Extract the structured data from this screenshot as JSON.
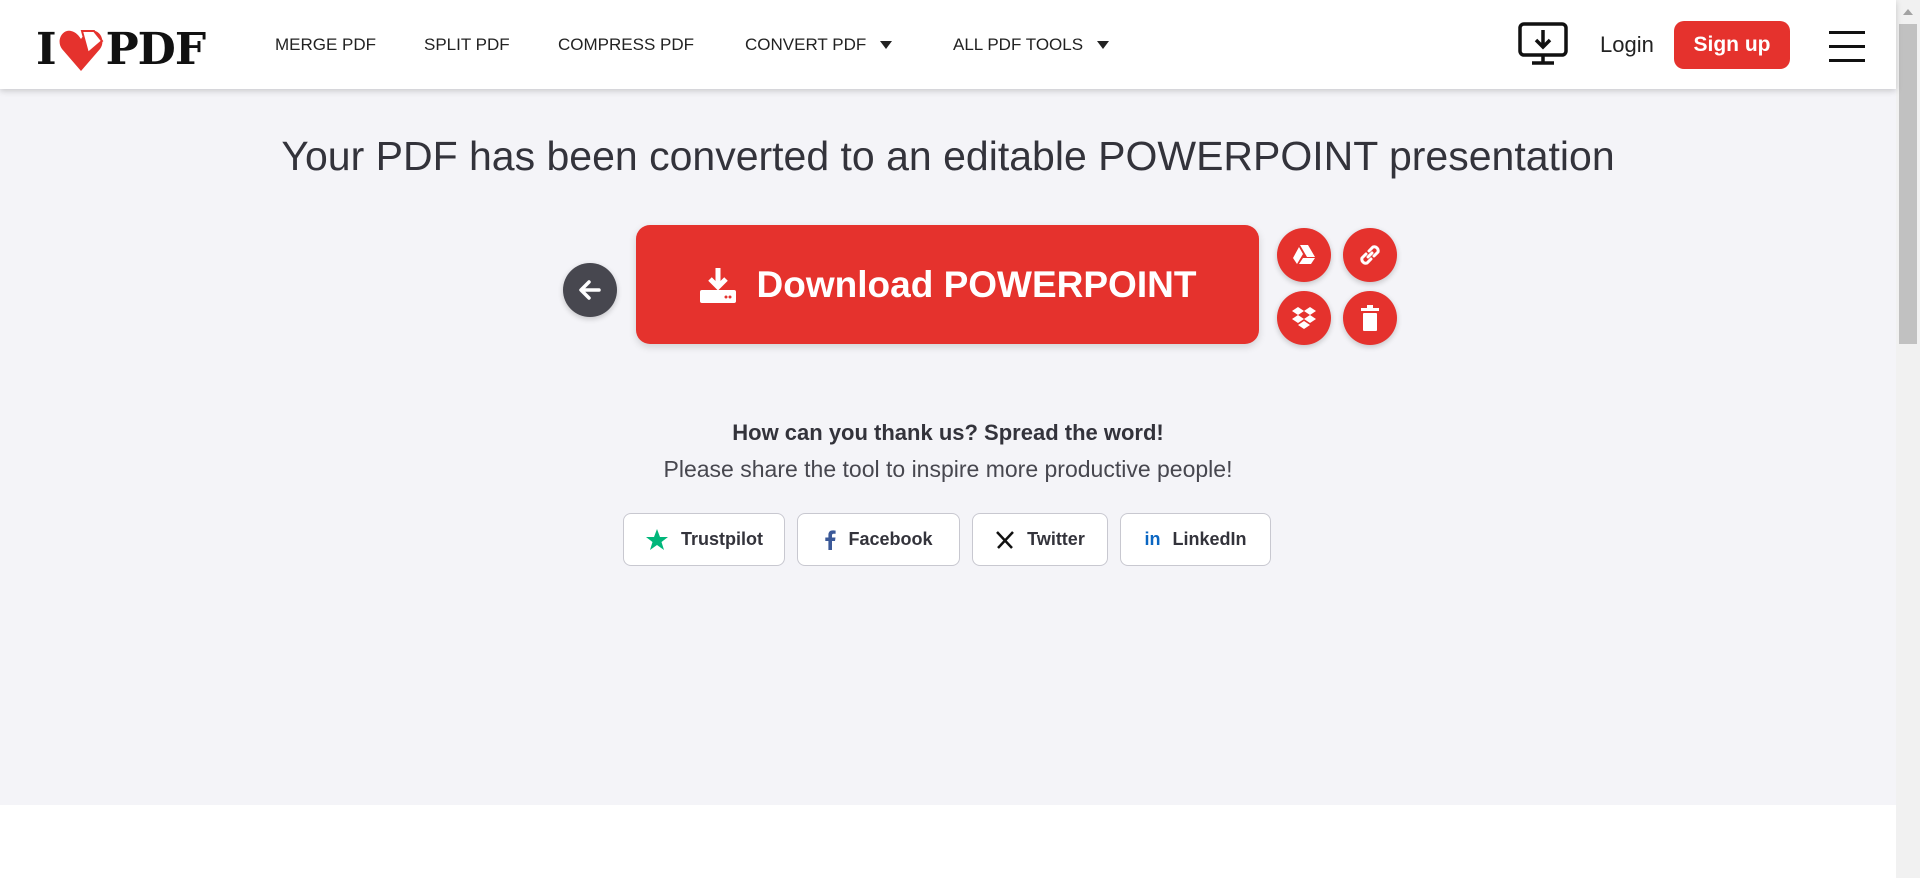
{
  "header": {
    "logo_text": "I ♥ PDF",
    "nav": [
      {
        "label": "MERGE PDF"
      },
      {
        "label": "SPLIT PDF"
      },
      {
        "label": "COMPRESS PDF"
      },
      {
        "label": "CONVERT PDF"
      },
      {
        "label": "ALL PDF TOOLS"
      }
    ],
    "login": "Login",
    "signup": "Sign up"
  },
  "main": {
    "title": "Your PDF has been converted to an editable POWERPOINT presentation",
    "download_label": "Download POWERPOINT",
    "thanks": "How can you thank us? Spread the word!",
    "share_sub": "Please share the tool to inspire more productive people!",
    "share": [
      {
        "label": "Trustpilot"
      },
      {
        "label": "Facebook"
      },
      {
        "label": "Twitter"
      },
      {
        "label": "LinkedIn"
      }
    ]
  },
  "colors": {
    "brand": "#e5322d",
    "background": "#f4f4f8",
    "back_button": "#47474f"
  }
}
